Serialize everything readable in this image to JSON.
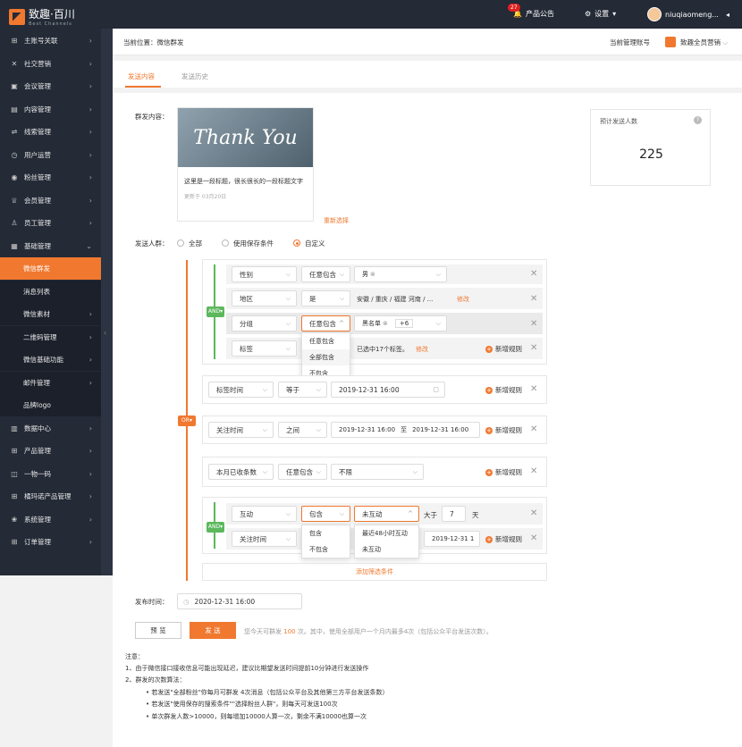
{
  "brand": {
    "name": "致趣·百川",
    "sub": "Best Channels"
  },
  "topbar": {
    "notify_count": "27",
    "notify_label": "产品公告",
    "settings_label": "设置",
    "user": "niuqiaomeng..."
  },
  "sidebar": {
    "items": [
      {
        "icon": "grid-icon",
        "glyph": "⊞",
        "label": "主账号关联"
      },
      {
        "icon": "social-icon",
        "glyph": "✕",
        "label": "社交营销"
      },
      {
        "icon": "meeting-icon",
        "glyph": "▣",
        "label": "会议管理"
      },
      {
        "icon": "content-icon",
        "glyph": "▤",
        "label": "内容管理"
      },
      {
        "icon": "clue-icon",
        "glyph": "⇌",
        "label": "线索管理"
      },
      {
        "icon": "user-op-icon",
        "glyph": "◷",
        "label": "用户运营"
      },
      {
        "icon": "fans-icon",
        "glyph": "◉",
        "label": "粉丝管理"
      },
      {
        "icon": "member-icon",
        "glyph": "♕",
        "label": "会员管理"
      },
      {
        "icon": "staff-icon",
        "glyph": "♙",
        "label": "员工管理"
      },
      {
        "icon": "basic-icon",
        "glyph": "▦",
        "label": "基础管理"
      }
    ],
    "sub_items": [
      "微信群发",
      "消息列表",
      "微信素材",
      "二维码管理",
      "微信基础功能",
      "邮件管理",
      "品牌logo"
    ],
    "items_after": [
      {
        "icon": "data-icon",
        "glyph": "▥",
        "label": "数据中心"
      },
      {
        "icon": "product-icon",
        "glyph": "⊞",
        "label": "产品管理"
      },
      {
        "icon": "code-icon",
        "glyph": "◫",
        "label": "一物一码"
      },
      {
        "icon": "platform-icon",
        "glyph": "⊞",
        "label": "橘玛诺产品管理"
      },
      {
        "icon": "system-icon",
        "glyph": "❀",
        "label": "系统管理"
      },
      {
        "icon": "order-icon",
        "glyph": "⊞",
        "label": "订单管理"
      }
    ]
  },
  "breadcrumb": {
    "prefix": "当前位置：",
    "page": "微信群发",
    "account_label": "当前管理账号",
    "account": "致趣全员营销"
  },
  "tabs": [
    "发送内容",
    "发送历史"
  ],
  "content": {
    "label": "群发内容：",
    "hero_text": "Thank You",
    "title": "这里是一段标题，很长很长的一段标题文字",
    "updated": "更新于 03月20日",
    "reselect": "重新选择"
  },
  "estimate": {
    "label": "预计发送人数",
    "value": "225"
  },
  "audience": {
    "label": "发送人群：",
    "options": [
      "全部",
      "使用保存条件",
      "自定义"
    ]
  },
  "and_label": "AND",
  "or_label": "OR",
  "group1": {
    "row1": {
      "field": "性别",
      "op": "任意包含",
      "tag": "男"
    },
    "row2": {
      "field": "地区",
      "op": "是",
      "value": "安徽 / 重庆 / 福建  河南 / ...",
      "edit": "修改"
    },
    "row3": {
      "field": "分组",
      "op": "任意包含",
      "tag": "黑名单",
      "more": "+6"
    },
    "row4": {
      "field": "标签",
      "value": "已选中17个标签。",
      "edit": "修改",
      "add": "新增规则"
    },
    "menu": [
      "任意包含",
      "全部包含",
      "不包含"
    ]
  },
  "rule2": {
    "field": "标签时间",
    "op": "等于",
    "date": "2019-12-31 16:00",
    "add": "新增规则"
  },
  "rule3": {
    "field": "关注时间",
    "op": "之间",
    "from": "2019-12-31 16:00",
    "to_word": "至",
    "to": "2019-12-31 16:00",
    "add": "新增规则"
  },
  "rule4": {
    "field": "本月已收条数",
    "op": "任意包含",
    "value": "不限",
    "add": "新增规则"
  },
  "group5": {
    "row1": {
      "field": "互动",
      "op": "包含",
      "value": "未互动",
      "gt": "大于",
      "days": "7",
      "unit": "天"
    },
    "row2": {
      "field": "关注时间",
      "date": "2019-12-31 1",
      "add": "新增规则"
    },
    "menu_a": [
      "包含",
      "不包含"
    ],
    "menu_b": [
      "最近48小时互动",
      "未互动"
    ]
  },
  "add_filter": "添加筛选条件",
  "publish": {
    "label": "发布时间：",
    "value": "2020-12-31 16:00"
  },
  "buttons": {
    "preview": "预 览",
    "send": "发 送"
  },
  "quota": {
    "pre": "您今天可群发 ",
    "num": "100",
    "post": " 次。其中，使用全部用户一个月内最多4次（包括公众平台发送次数）。"
  },
  "notes": [
    "注意：",
    "1、由于微信接口接收信息可能出现延迟，建议比期望发送时间提前10分钟进行发送操作",
    "2、群发的次数算法：",
    "• 若发送\"全部粉丝\"你每月可群发 4次消息（包括公众平台及其他第三方平台发送条数）",
    "• 若发送\"使用保存的搜索条件\"\"选择粉丝人群\"，则每天可发送100次",
    "• 单次群发人数>10000，则每增加10000人算一次，剩余不满10000也算一次"
  ],
  "colors": {
    "accent": "#f0782f",
    "sidebar": "#242a36",
    "and_green": "#5cb85c"
  }
}
